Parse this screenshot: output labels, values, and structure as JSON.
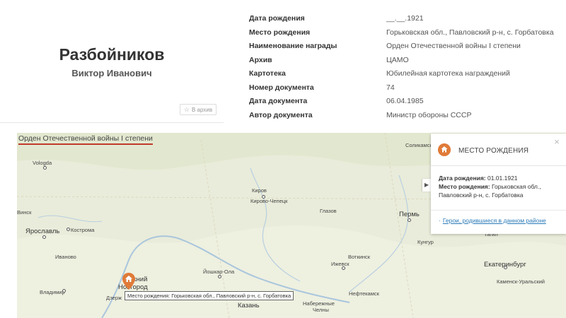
{
  "person": {
    "surname": "Разбойников",
    "given_names": "Виктор Иванович",
    "archive_button_label": "В архив",
    "archive_icon": "star-icon"
  },
  "info": [
    {
      "label": "Дата рождения",
      "value": "__.__.1921"
    },
    {
      "label": "Место рождения",
      "value": "Горьковская обл., Павловский р-н, с. Горбатовка"
    },
    {
      "label": "Наименование награды",
      "value": "Орден Отечественной войны I степени"
    },
    {
      "label": "Архив",
      "value": "ЦАМО"
    },
    {
      "label": "Картотека",
      "value": "Юбилейная картотека награждений"
    },
    {
      "label": "Номер документа",
      "value": "74"
    },
    {
      "label": "Дата документа",
      "value": "06.04.1985"
    },
    {
      "label": "Автор документа",
      "value": "Министр обороны СССР"
    }
  ],
  "tab": {
    "label": "Орден Отечественной войны I степени"
  },
  "map": {
    "marker_tooltip": "Место рождения: Горьковская обл., Павловский р-н, с. Горбатовка",
    "cities": [
      {
        "name": "Vologda",
        "label": "Vologda"
      },
      {
        "name": "kirov",
        "label": "Киров"
      },
      {
        "name": "kirovo-chepetsk",
        "label": "Кирово-Чепецк"
      },
      {
        "name": "glazov",
        "label": "Глазов"
      },
      {
        "name": "perm",
        "label": "Пермь"
      },
      {
        "name": "yaroslavl",
        "label": "Ярославль"
      },
      {
        "name": "kostroma",
        "label": "Кострома"
      },
      {
        "name": "ivanovo",
        "label": "Иваново"
      },
      {
        "name": "votkinsk",
        "label": "Воткинск"
      },
      {
        "name": "izhevsk",
        "label": "Ижевск"
      },
      {
        "name": "kungur",
        "label": "Кунгур"
      },
      {
        "name": "tagil",
        "label": "Тагил"
      },
      {
        "name": "yekaterinburg",
        "label": "Екатеринбург"
      },
      {
        "name": "nizhny-top",
        "label": "Нижний"
      },
      {
        "name": "nizhny-bottom",
        "label": "Новгород"
      },
      {
        "name": "yoshkar-ola",
        "label": "Йошкар-Ола"
      },
      {
        "name": "vladimir",
        "label": "Владимир"
      },
      {
        "name": "dzerzhinsk",
        "label": "Дзерж"
      },
      {
        "name": "neftekamsk",
        "label": "Нефтекамск"
      },
      {
        "name": "kamensk",
        "label": "Каменск-Уральский"
      },
      {
        "name": "naberezhnye",
        "label": "Набережные"
      },
      {
        "name": "chelny",
        "label": "Челны"
      },
      {
        "name": "kazan",
        "label": "Казань"
      },
      {
        "name": "solikamsk",
        "label": "Соликамск"
      },
      {
        "name": "vinsk",
        "label": "Винск"
      }
    ]
  },
  "panel": {
    "title": "МЕСТО РОЖДЕНИЯ",
    "birth_date_label": "Дата рождения:",
    "birth_date_value": "01.01.1921",
    "birth_place_label": "Место рождения:",
    "birth_place_value": "Горьковская обл., Павловский р-н, с. Горбатовка",
    "link_label": "Герои, родившиеся в данном районе",
    "close_glyph": "×",
    "toggle_glyph": "▶",
    "icon": "home-icon",
    "accent_color": "#e07b39"
  },
  "colors": {
    "tab_underline": "#c0392b",
    "link": "#2a7ab8",
    "map_land": "#e9ecda"
  }
}
